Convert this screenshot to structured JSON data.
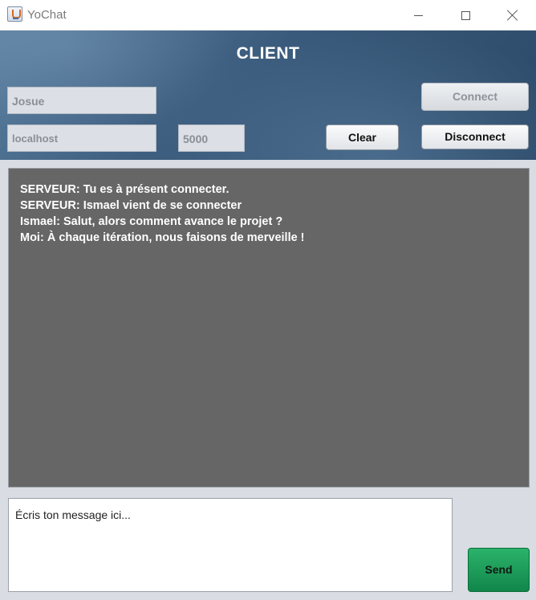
{
  "window": {
    "title": "YoChat",
    "app_icon": "java-cup-icon"
  },
  "header": {
    "title": "CLIENT"
  },
  "connection": {
    "username_value": "Josue",
    "host_value": "localhost",
    "port_value": "5000",
    "connect_label": "Connect",
    "clear_label": "Clear",
    "disconnect_label": "Disconnect"
  },
  "chat": {
    "lines": [
      "SERVEUR: Tu es à présent connecter.",
      "SERVEUR: Ismael vient de se connecter",
      "Ismael: Salut, alors comment avance le projet ?",
      "Moi: À chaque itération, nous faisons de merveille !"
    ]
  },
  "compose": {
    "placeholder": "Écris ton message ici...",
    "send_label": "Send"
  },
  "colors": {
    "chat_background": "#666666",
    "send_button": "#1a9a55",
    "header_gradient": "#3a5a7b"
  }
}
